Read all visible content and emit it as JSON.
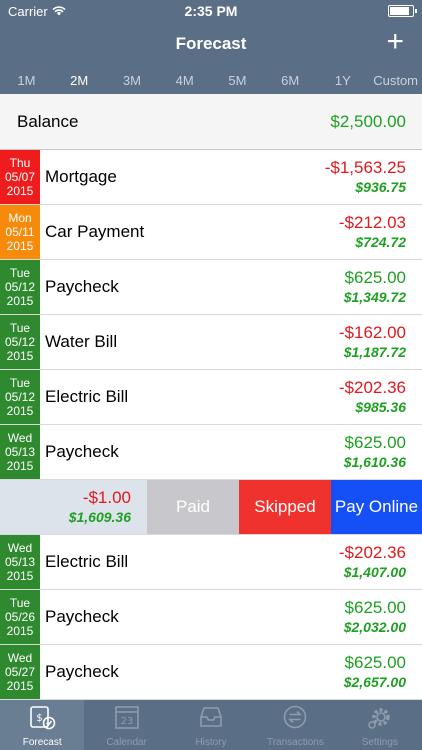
{
  "status": {
    "carrier": "Carrier",
    "time": "2:35 PM"
  },
  "nav": {
    "title": "Forecast",
    "add_label": "+"
  },
  "ranges": [
    {
      "label": "1M",
      "active": false
    },
    {
      "label": "2M",
      "active": true
    },
    {
      "label": "3M",
      "active": false
    },
    {
      "label": "4M",
      "active": false
    },
    {
      "label": "5M",
      "active": false
    },
    {
      "label": "6M",
      "active": false
    },
    {
      "label": "1Y",
      "active": false
    },
    {
      "label": "Custom",
      "active": false
    }
  ],
  "balance": {
    "label": "Balance",
    "value": "$2,500.00"
  },
  "rows": [
    {
      "day": "Thu",
      "date": "05/07",
      "year": "2015",
      "color": "red",
      "name": "Mortgage",
      "amount": "-$1,563.25",
      "amount_type": "neg",
      "running": "$936.75"
    },
    {
      "day": "Mon",
      "date": "05/11",
      "year": "2015",
      "color": "orange",
      "name": "Car Payment",
      "amount": "-$212.03",
      "amount_type": "neg",
      "running": "$724.72"
    },
    {
      "day": "Tue",
      "date": "05/12",
      "year": "2015",
      "color": "green",
      "name": "Paycheck",
      "amount": "$625.00",
      "amount_type": "pos",
      "running": "$1,349.72"
    },
    {
      "day": "Tue",
      "date": "05/12",
      "year": "2015",
      "color": "green",
      "name": "Water Bill",
      "amount": "-$162.00",
      "amount_type": "neg",
      "running": "$1,187.72"
    },
    {
      "day": "Tue",
      "date": "05/12",
      "year": "2015",
      "color": "green",
      "name": "Electric Bill",
      "amount": "-$202.36",
      "amount_type": "neg",
      "running": "$985.36"
    },
    {
      "day": "Wed",
      "date": "05/13",
      "year": "2015",
      "color": "green",
      "name": "Paycheck",
      "amount": "$625.00",
      "amount_type": "pos",
      "running": "$1,610.36"
    }
  ],
  "swipe": {
    "amount": "-$1.00",
    "running": "$1,609.36",
    "paid_label": "Paid",
    "skipped_label": "Skipped",
    "online_label": "Pay Online"
  },
  "rows2": [
    {
      "day": "Wed",
      "date": "05/13",
      "year": "2015",
      "color": "green",
      "name": "Electric Bill",
      "amount": "-$202.36",
      "amount_type": "neg",
      "running": "$1,407.00"
    },
    {
      "day": "Tue",
      "date": "05/26",
      "year": "2015",
      "color": "green",
      "name": "Paycheck",
      "amount": "$625.00",
      "amount_type": "pos",
      "running": "$2,032.00"
    },
    {
      "day": "Wed",
      "date": "05/27",
      "year": "2015",
      "color": "green",
      "name": "Paycheck",
      "amount": "$625.00",
      "amount_type": "pos",
      "running": "$2,657.00"
    }
  ],
  "tabs": [
    {
      "label": "Forecast",
      "icon": "forecast-icon",
      "active": true
    },
    {
      "label": "Calendar",
      "icon": "calendar-icon",
      "calendar_number": "23",
      "active": false
    },
    {
      "label": "History",
      "icon": "inbox-icon",
      "active": false
    },
    {
      "label": "Transactions",
      "icon": "transactions-icon",
      "active": false
    },
    {
      "label": "Settings",
      "icon": "gear-icon",
      "active": false
    }
  ]
}
